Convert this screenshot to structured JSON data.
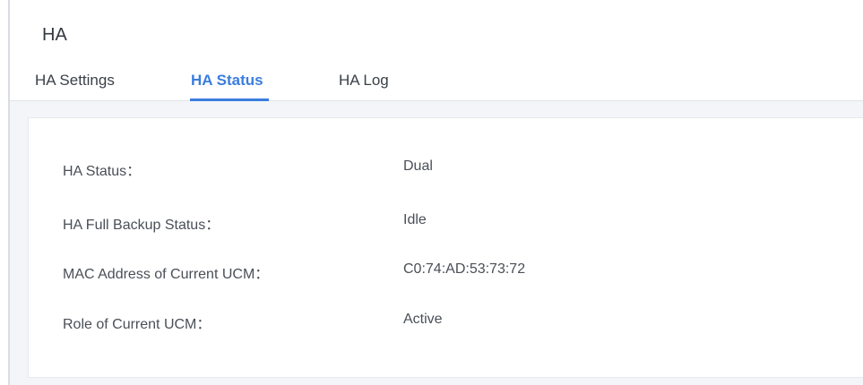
{
  "page": {
    "title": "HA"
  },
  "tabs": [
    {
      "label": "HA Settings",
      "active": false
    },
    {
      "label": "HA Status",
      "active": true
    },
    {
      "label": "HA Log",
      "active": false
    }
  ],
  "colors": {
    "accent": "#3b7ddd",
    "text": "#4a4f57",
    "background": "#f3f5f8"
  },
  "status": {
    "rows": [
      {
        "label": "HA Status：",
        "value": "Dual"
      },
      {
        "label": "HA Full Backup Status：",
        "value": "Idle"
      },
      {
        "label": "MAC Address of Current UCM：",
        "value": "C0:74:AD:53:73:72"
      },
      {
        "label": "Role of Current UCM：",
        "value": "Active"
      }
    ]
  }
}
